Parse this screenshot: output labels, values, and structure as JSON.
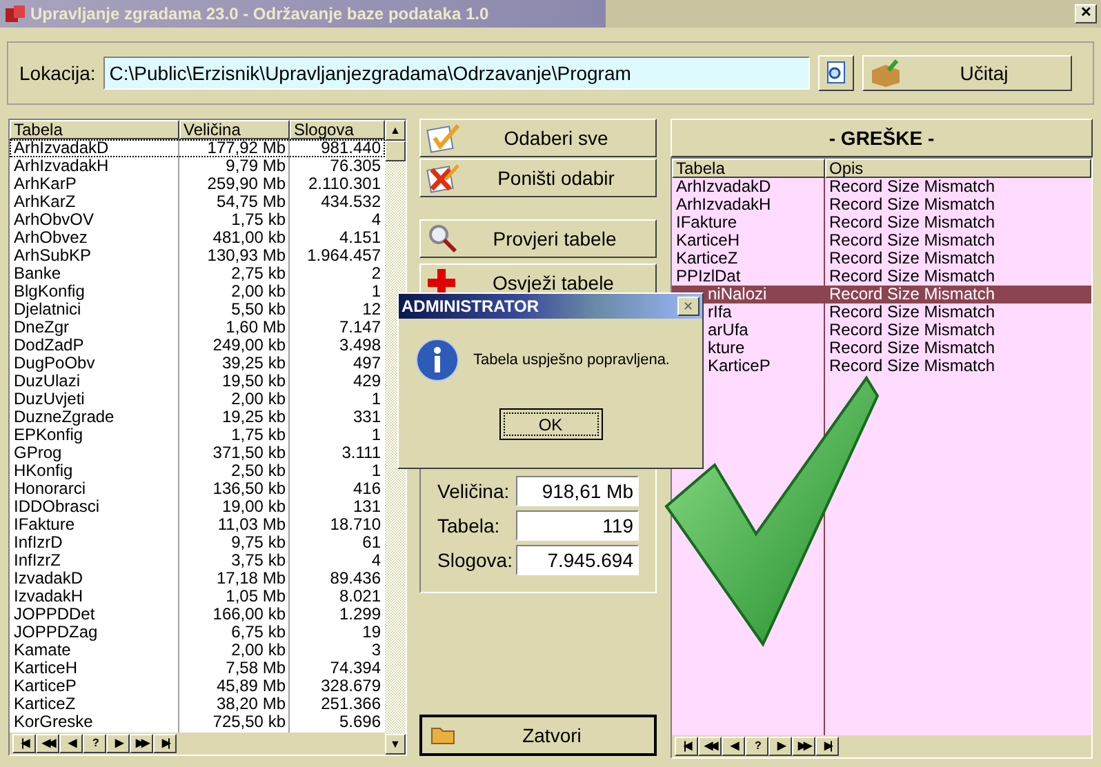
{
  "window": {
    "title": "Upravljanje zgradama 23.0 - Održavanje baze podataka 1.0",
    "close": "✕"
  },
  "location": {
    "label": "Lokacija:",
    "value": "C:\\Public\\Erzisnik\\Upravljanjezgradama\\Odrzavanje\\Program",
    "load_button": "Učitaj"
  },
  "tables": {
    "columns": [
      "Tabela",
      "Veličina",
      "Slogova"
    ],
    "rows": [
      {
        "name": "ArhIzvadakD",
        "size": "177,92 Mb",
        "records": "981.440",
        "selected": true
      },
      {
        "name": "ArhIzvadakH",
        "size": "9,79 Mb",
        "records": "76.305",
        "selected": false
      },
      {
        "name": "ArhKarP",
        "size": "259,90 Mb",
        "records": "2.110.301",
        "selected": false
      },
      {
        "name": "ArhKarZ",
        "size": "54,75 Mb",
        "records": "434.532",
        "selected": false
      },
      {
        "name": "ArhObvOV",
        "size": "1,75 kb",
        "records": "4",
        "selected": false
      },
      {
        "name": "ArhObvez",
        "size": "481,00 kb",
        "records": "4.151",
        "selected": false
      },
      {
        "name": "ArhSubKP",
        "size": "130,93 Mb",
        "records": "1.964.457",
        "selected": false
      },
      {
        "name": "Banke",
        "size": "2,75 kb",
        "records": "2",
        "selected": false
      },
      {
        "name": "BlgKonfig",
        "size": "2,00 kb",
        "records": "1",
        "selected": false
      },
      {
        "name": "Djelatnici",
        "size": "5,50 kb",
        "records": "12",
        "selected": false
      },
      {
        "name": "DneZgr",
        "size": "1,60 Mb",
        "records": "7.147",
        "selected": false
      },
      {
        "name": "DodZadP",
        "size": "249,00 kb",
        "records": "3.498",
        "selected": false
      },
      {
        "name": "DugPoObv",
        "size": "39,25 kb",
        "records": "497",
        "selected": false
      },
      {
        "name": "DuzUlazi",
        "size": "19,50 kb",
        "records": "429",
        "selected": false
      },
      {
        "name": "DuzUvjeti",
        "size": "2,00 kb",
        "records": "1",
        "selected": false
      },
      {
        "name": "DuzneZgrade",
        "size": "19,25 kb",
        "records": "331",
        "selected": false
      },
      {
        "name": "EPKonfig",
        "size": "1,75 kb",
        "records": "1",
        "selected": false
      },
      {
        "name": "GProg",
        "size": "371,50 kb",
        "records": "3.111",
        "selected": false
      },
      {
        "name": "HKonfig",
        "size": "2,50 kb",
        "records": "1",
        "selected": false
      },
      {
        "name": "Honorarci",
        "size": "136,50 kb",
        "records": "416",
        "selected": false
      },
      {
        "name": "IDDObrasci",
        "size": "19,00 kb",
        "records": "131",
        "selected": false
      },
      {
        "name": "IFakture",
        "size": "11,03 Mb",
        "records": "18.710",
        "selected": false
      },
      {
        "name": "InfIzrD",
        "size": "9,75 kb",
        "records": "61",
        "selected": false
      },
      {
        "name": "InfIzrZ",
        "size": "3,75 kb",
        "records": "4",
        "selected": false
      },
      {
        "name": "IzvadakD",
        "size": "17,18 Mb",
        "records": "89.436",
        "selected": false
      },
      {
        "name": "IzvadakH",
        "size": "1,05 Mb",
        "records": "8.021",
        "selected": false
      },
      {
        "name": "JOPPDDet",
        "size": "166,00 kb",
        "records": "1.299",
        "selected": false
      },
      {
        "name": "JOPPDZag",
        "size": "6,75 kb",
        "records": "19",
        "selected": false
      },
      {
        "name": "Kamate",
        "size": "2,00 kb",
        "records": "3",
        "selected": false
      },
      {
        "name": "KarticeH",
        "size": "7,58 Mb",
        "records": "74.394",
        "selected": false
      },
      {
        "name": "KarticeP",
        "size": "45,89 Mb",
        "records": "328.679",
        "selected": false
      },
      {
        "name": "KarticeZ",
        "size": "38,20 Mb",
        "records": "251.366",
        "selected": false
      },
      {
        "name": "KorGreske",
        "size": "725,50 kb",
        "records": "5.696",
        "selected": false
      }
    ],
    "navigator": [
      "|◀",
      "◀◀",
      "◀",
      "?",
      "▶",
      "▶▶",
      "▶|"
    ]
  },
  "actions": [
    {
      "label": "Odaberi sve",
      "kind": "check"
    },
    {
      "label": "Poništi odabir",
      "kind": "cross"
    },
    {
      "label": "Provjeri tabele",
      "kind": "magnifier"
    },
    {
      "label": "Osvježi tabele",
      "kind": "plus"
    }
  ],
  "scroll_arrows": [
    "▲",
    "▼"
  ],
  "stats": [
    {
      "label": "Veličina:",
      "value": "918,61 Mb"
    },
    {
      "label": "Tabela:",
      "value": "119"
    },
    {
      "label": "Slogova:",
      "value": "7.945.694"
    }
  ],
  "close_button": "Zatvori",
  "errors": {
    "title": "- GREŠKE -",
    "columns": [
      "Tabela",
      "Opis"
    ],
    "rows": [
      {
        "table": "ArhIzvadakD",
        "description": "Record Size Mismatch",
        "selected": false,
        "partial": false
      },
      {
        "table": "ArhIzvadakH",
        "description": "Record Size Mismatch",
        "selected": false,
        "partial": false
      },
      {
        "table": "IFakture",
        "description": "Record Size Mismatch",
        "selected": false,
        "partial": false
      },
      {
        "table": "KarticeH",
        "description": "Record Size Mismatch",
        "selected": false,
        "partial": false
      },
      {
        "table": "KarticeZ",
        "description": "Record Size Mismatch",
        "selected": false,
        "partial": false
      },
      {
        "table": "PPIzlDat",
        "description": "Record Size Mismatch",
        "selected": false,
        "partial": false
      },
      {
        "table": "niNalozi",
        "description": "Record Size Mismatch",
        "selected": true,
        "partial": true
      },
      {
        "table": "rIfa",
        "description": "Record Size Mismatch",
        "selected": false,
        "partial": true
      },
      {
        "table": "arUfa",
        "description": "Record Size Mismatch",
        "selected": false,
        "partial": true
      },
      {
        "table": "kture",
        "description": "Record Size Mismatch",
        "selected": false,
        "partial": true
      },
      {
        "table": "KarticeP",
        "description": "Record Size Mismatch",
        "selected": false,
        "partial": true
      }
    ],
    "navigator": [
      "|◀",
      "◀◀",
      "◀",
      "?",
      "▶",
      "▶▶",
      "▶|"
    ]
  },
  "dialog": {
    "title": "ADMINISTRATOR",
    "close": "✕",
    "message": "Tabela uspješno popravljena.",
    "ok": "OK"
  }
}
